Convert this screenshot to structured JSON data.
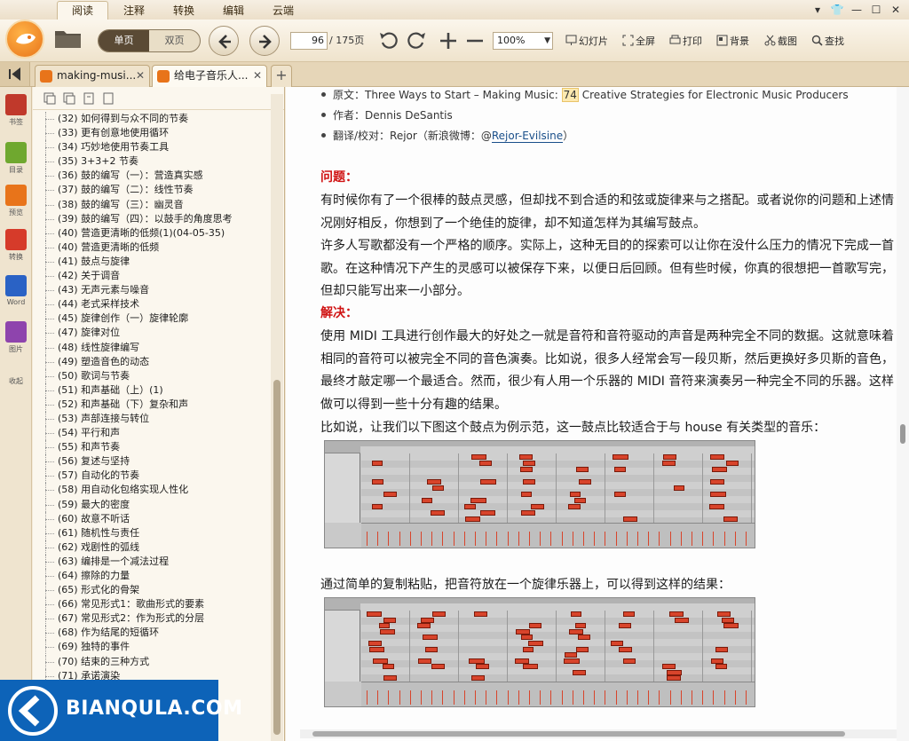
{
  "menubar": {
    "tabs": [
      "阅读",
      "注释",
      "转换",
      "编辑",
      "云端"
    ],
    "active_index": 0
  },
  "toolbar": {
    "single_page": "单页",
    "double_page": "双页",
    "current_page": "96",
    "total_pages": "/ 175页",
    "zoom": "100%",
    "slideshow": "幻灯片",
    "fullscreen": "全屏",
    "print": "打印",
    "background": "背景",
    "screenshot": "截图",
    "search": "查找"
  },
  "doc_tabs": [
    {
      "title": "making-musi..."
    },
    {
      "title": "给电子音乐人..."
    }
  ],
  "rail": [
    {
      "label": "书签",
      "icon": "bookmark-icon",
      "color": "#c0392b"
    },
    {
      "label": "目录",
      "icon": "toc-icon",
      "color": "#6fa82f"
    },
    {
      "label": "预览",
      "icon": "preview-icon",
      "color": "#e8741a"
    },
    {
      "label": "转换",
      "icon": "convert-pdf-icon",
      "color": "#d63b2a"
    },
    {
      "label": "Word",
      "icon": "word-icon",
      "color": "#2a62c5"
    },
    {
      "label": "图片",
      "icon": "image-icon",
      "color": "#8e44ad"
    },
    {
      "label": "收起",
      "icon": "collapse-icon",
      "color": "#888888"
    }
  ],
  "toc": [
    "(32) 如何得到与众不同的节奏",
    "(33) 更有创意地使用循环",
    "(34) 巧妙地使用节奏工具",
    "(35) 3+3+2 节奏",
    "(36) 鼓的编写（一）：营造真实感",
    "(37) 鼓的编写（二）：线性节奏",
    "(38) 鼓的编写（三）：幽灵音",
    "(39) 鼓的编写（四）：以鼓手的角度思考",
    "(40) 营造更清晰的低频(1)(04-05-35)",
    "(40) 营造更清晰的低频",
    "(41) 鼓点与旋律",
    "(42) 关于调音",
    "(43) 无声元素与噪音",
    "(44) 老式采样技术",
    "(45) 旋律创作（一）旋律轮廓",
    "(47) 旋律对位",
    "(48) 线性旋律编写",
    "(49) 塑造音色的动态",
    "(50) 歌词与节奏",
    "(51) 和声基础（上）(1)",
    "(52) 和声基础（下）复杂和声",
    "(53) 声部连接与转位",
    "(54) 平行和声",
    "(55) 和声节奏",
    "(56) 复述与坚持",
    "(57) 自动化的节奏",
    "(58) 用自动化包络实现人性化",
    "(59) 最大的密度",
    "(60) 故意不听话",
    "(61) 随机性与责任",
    "(62) 戏剧性的弧线",
    "(63) 编排是一个减法过程",
    "(64) 擦除的力量",
    "(65) 形式化的骨架",
    "(66) 常见形式1：歌曲形式的要素",
    "(67) 常见形式2：作为形式的分层",
    "(68) 作为结尾的短循环",
    "(69) 独特的事件",
    "(70) 结束的三种方式",
    "(71) 承诺演染"
  ],
  "content": {
    "meta_source_prefix": "原文：Three Ways to Start – Making Music: ",
    "meta_source_hl": "74",
    "meta_source_suffix": " Creative Strategies for Electronic Music Producers",
    "meta_author": "作者：Dennis DeSantis",
    "meta_translator_prefix": "翻译/校对：Rejor（新浪微博：@",
    "meta_translator_link": "Rejor-Evilsine",
    "meta_translator_suffix": "）",
    "problem_heading": "问题：",
    "problem_p1": "有时候你有了一个很棒的鼓点灵感，但却找不到合适的和弦或旋律来与之搭配。或者说你的问题和上述情况刚好相反，你想到了一个绝佳的旋律，却不知道怎样为其编写鼓点。",
    "problem_p2": "许多人写歌都没有一个严格的顺序。实际上，这种无目的的探索可以让你在没什么压力的情况下完成一首歌。在这种情况下产生的灵感可以被保存下来，以便日后回顾。但有些时候，你真的很想把一首歌写完，但却只能写出来一小部分。",
    "solution_heading": "解决：",
    "solution_p1": "使用 MIDI 工具进行创作最大的好处之一就是音符和音符驱动的声音是两种完全不同的数据。这就意味着相同的音符可以被完全不同的音色演奏。比如说，很多人经常会写一段贝斯，然后更换好多贝斯的音色，最终才敲定哪一个最适合。然而，很少有人用一个乐器的 MIDI 音符来演奏另一种完全不同的乐器。这样做可以得到一些十分有趣的结果。",
    "example_intro": "比如说，让我们以下图这个鼓点为例示范，这一鼓点比较适合于与 house 有关类型的音乐：",
    "copy_intro": "通过简单的复制粘贴，把音符放在一个旋律乐器上，可以得到这样的结果："
  },
  "watermark": {
    "text": "BIANQULA.COM"
  }
}
